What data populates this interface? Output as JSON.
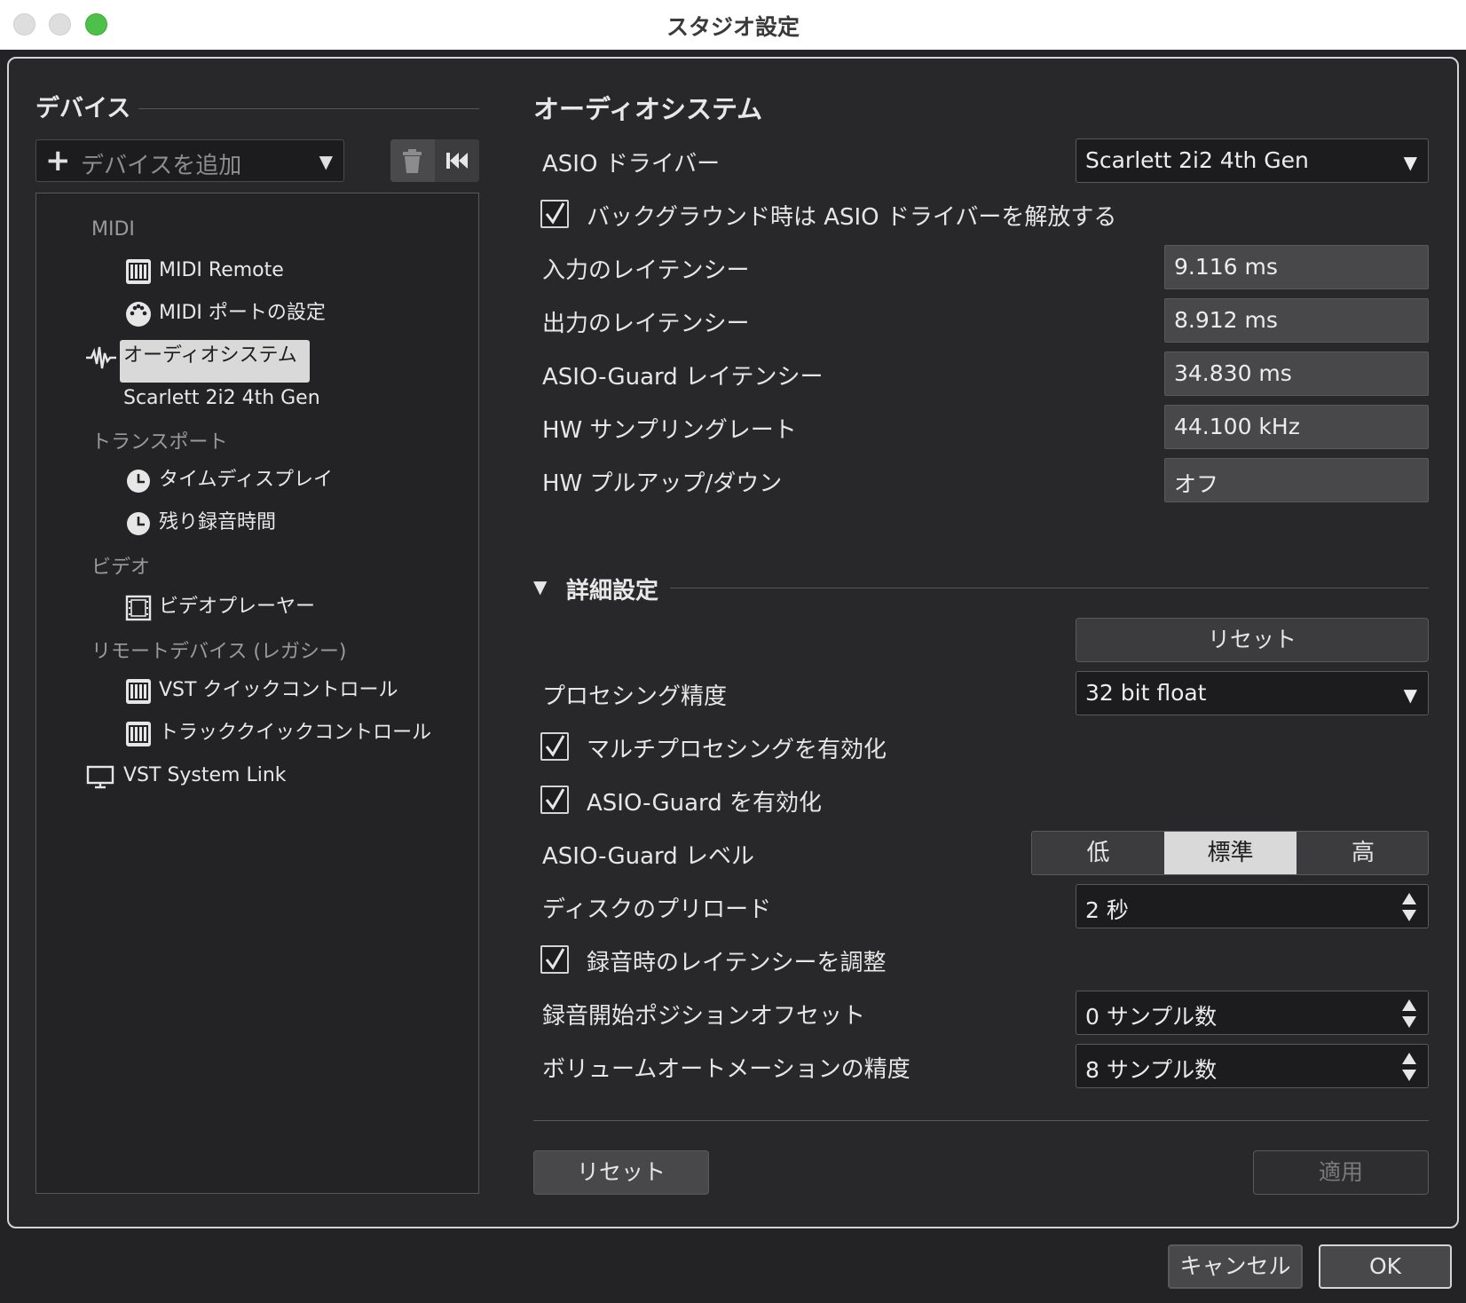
{
  "window": {
    "title": "スタジオ設定"
  },
  "left_panel": {
    "section_title": "デバイス",
    "add_device": {
      "placeholder": "デバイスを追加"
    },
    "tree": {
      "cat_midi": "MIDI",
      "midi_remote": "MIDI Remote",
      "midi_port": "MIDI ポートの設定",
      "audio_system": "オーディオシステム",
      "scarlett": "Scarlett 2i2 4th Gen",
      "cat_transport": "トランスポート",
      "time_display": "タイムディスプレイ",
      "remaining_time": "残り録音時間",
      "cat_video": "ビデオ",
      "video_player": "ビデオプレーヤー",
      "cat_remote_legacy": "リモートデバイス (レガシー)",
      "vst_quick": "VST クイックコントロール",
      "track_quick": "トラッククイックコントロール",
      "vst_system_link": "VST System Link"
    }
  },
  "right_panel": {
    "title": "オーディオシステム",
    "asio_driver": {
      "label": "ASIO ドライバー",
      "value": "Scarlett 2i2 4th Gen"
    },
    "release_driver": {
      "label": "バックグラウンド時は ASIO ドライバーを解放する",
      "checked": true
    },
    "input_latency": {
      "label": "入力のレイテンシー",
      "value": "9.116 ms"
    },
    "output_latency": {
      "label": "出力のレイテンシー",
      "value": "8.912 ms"
    },
    "asio_guard_latency": {
      "label": "ASIO-Guard レイテンシー",
      "value": "34.830 ms"
    },
    "hw_sample_rate": {
      "label": "HW サンプリングレート",
      "value": "44.100 kHz"
    },
    "hw_pullup": {
      "label": "HW プルアップ/ダウン",
      "value": "オフ"
    },
    "advanced": {
      "title": "詳細設定",
      "reset_label": "リセット",
      "processing_precision": {
        "label": "プロセシング精度",
        "value": "32 bit float"
      },
      "multiprocessing": {
        "label": "マルチプロセシングを有効化",
        "checked": true
      },
      "asio_guard_enable": {
        "label": "ASIO-Guard を有効化",
        "checked": true
      },
      "asio_guard_level": {
        "label": "ASIO-Guard レベル",
        "options": [
          "低",
          "標準",
          "高"
        ],
        "selected": "標準"
      },
      "disk_preload": {
        "label": "ディスクのプリロード",
        "value": "2 秒"
      },
      "adjust_latency": {
        "label": "録音時のレイテンシーを調整",
        "checked": true
      },
      "record_offset": {
        "label": "録音開始ポジションオフセット",
        "value": "0 サンプル数"
      },
      "volume_automation": {
        "label": "ボリュームオートメーションの精度",
        "value": "8 サンプル数"
      }
    },
    "bottom": {
      "reset_label": "リセット",
      "apply_label": "適用"
    }
  },
  "footer": {
    "cancel_label": "キャンセル",
    "ok_label": "OK"
  },
  "colors": {
    "accent_zoom": "#4cc048",
    "background": "#28282a",
    "selected_row": "#d9d9d9"
  }
}
